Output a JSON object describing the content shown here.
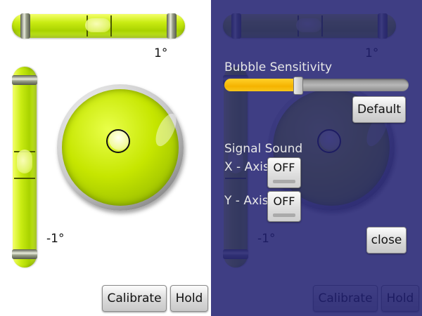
{
  "level": {
    "horizontal_reading": "1°",
    "vertical_reading": "-1°"
  },
  "buttons": {
    "calibrate": "Calibrate",
    "hold": "Hold"
  },
  "settings": {
    "bubble_sensitivity_label": "Bubble Sensitivity",
    "bubble_sensitivity_value": 0.4,
    "default_button": "Default",
    "signal_sound_label": "Signal Sound",
    "x_axis_label": "X - Axis",
    "x_axis_toggle": "OFF",
    "y_axis_label": "Y - Axis",
    "y_axis_toggle": "OFF",
    "close_button": "close"
  },
  "colors": {
    "vial_green": "#c6e600",
    "overlay": "#201e70",
    "slider_fill": "#f5b300"
  }
}
